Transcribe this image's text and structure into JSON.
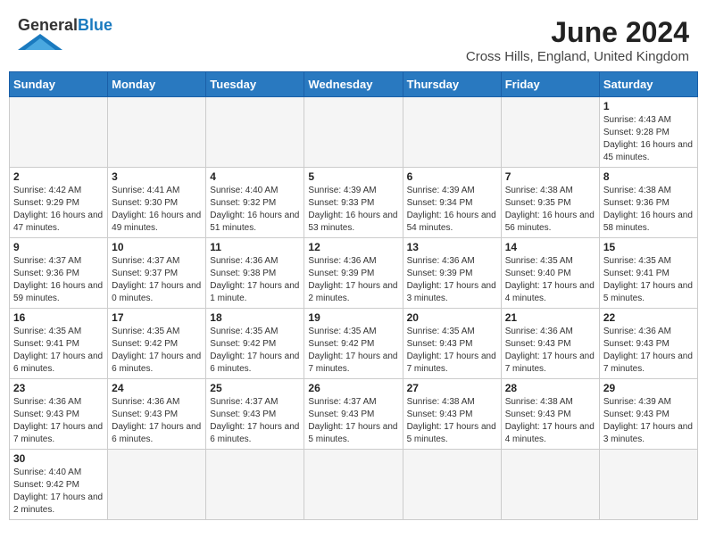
{
  "header": {
    "logo_general": "General",
    "logo_blue": "Blue",
    "month_year": "June 2024",
    "location": "Cross Hills, England, United Kingdom"
  },
  "days_of_week": [
    "Sunday",
    "Monday",
    "Tuesday",
    "Wednesday",
    "Thursday",
    "Friday",
    "Saturday"
  ],
  "weeks": [
    [
      {
        "day": "",
        "empty": true
      },
      {
        "day": "",
        "empty": true
      },
      {
        "day": "",
        "empty": true
      },
      {
        "day": "",
        "empty": true
      },
      {
        "day": "",
        "empty": true
      },
      {
        "day": "",
        "empty": true
      },
      {
        "day": "1",
        "sunrise": "4:43 AM",
        "sunset": "9:28 PM",
        "daylight": "16 hours and 45 minutes."
      }
    ],
    [
      {
        "day": "2",
        "sunrise": "4:42 AM",
        "sunset": "9:29 PM",
        "daylight": "16 hours and 47 minutes."
      },
      {
        "day": "3",
        "sunrise": "4:41 AM",
        "sunset": "9:30 PM",
        "daylight": "16 hours and 49 minutes."
      },
      {
        "day": "4",
        "sunrise": "4:40 AM",
        "sunset": "9:32 PM",
        "daylight": "16 hours and 51 minutes."
      },
      {
        "day": "5",
        "sunrise": "4:39 AM",
        "sunset": "9:33 PM",
        "daylight": "16 hours and 53 minutes."
      },
      {
        "day": "6",
        "sunrise": "4:39 AM",
        "sunset": "9:34 PM",
        "daylight": "16 hours and 54 minutes."
      },
      {
        "day": "7",
        "sunrise": "4:38 AM",
        "sunset": "9:35 PM",
        "daylight": "16 hours and 56 minutes."
      },
      {
        "day": "8",
        "sunrise": "4:38 AM",
        "sunset": "9:36 PM",
        "daylight": "16 hours and 58 minutes."
      }
    ],
    [
      {
        "day": "9",
        "sunrise": "4:37 AM",
        "sunset": "9:36 PM",
        "daylight": "16 hours and 59 minutes."
      },
      {
        "day": "10",
        "sunrise": "4:37 AM",
        "sunset": "9:37 PM",
        "daylight": "17 hours and 0 minutes."
      },
      {
        "day": "11",
        "sunrise": "4:36 AM",
        "sunset": "9:38 PM",
        "daylight": "17 hours and 1 minute."
      },
      {
        "day": "12",
        "sunrise": "4:36 AM",
        "sunset": "9:39 PM",
        "daylight": "17 hours and 2 minutes."
      },
      {
        "day": "13",
        "sunrise": "4:36 AM",
        "sunset": "9:39 PM",
        "daylight": "17 hours and 3 minutes."
      },
      {
        "day": "14",
        "sunrise": "4:35 AM",
        "sunset": "9:40 PM",
        "daylight": "17 hours and 4 minutes."
      },
      {
        "day": "15",
        "sunrise": "4:35 AM",
        "sunset": "9:41 PM",
        "daylight": "17 hours and 5 minutes."
      }
    ],
    [
      {
        "day": "16",
        "sunrise": "4:35 AM",
        "sunset": "9:41 PM",
        "daylight": "17 hours and 6 minutes."
      },
      {
        "day": "17",
        "sunrise": "4:35 AM",
        "sunset": "9:42 PM",
        "daylight": "17 hours and 6 minutes."
      },
      {
        "day": "18",
        "sunrise": "4:35 AM",
        "sunset": "9:42 PM",
        "daylight": "17 hours and 6 minutes."
      },
      {
        "day": "19",
        "sunrise": "4:35 AM",
        "sunset": "9:42 PM",
        "daylight": "17 hours and 7 minutes."
      },
      {
        "day": "20",
        "sunrise": "4:35 AM",
        "sunset": "9:43 PM",
        "daylight": "17 hours and 7 minutes."
      },
      {
        "day": "21",
        "sunrise": "4:36 AM",
        "sunset": "9:43 PM",
        "daylight": "17 hours and 7 minutes."
      },
      {
        "day": "22",
        "sunrise": "4:36 AM",
        "sunset": "9:43 PM",
        "daylight": "17 hours and 7 minutes."
      }
    ],
    [
      {
        "day": "23",
        "sunrise": "4:36 AM",
        "sunset": "9:43 PM",
        "daylight": "17 hours and 7 minutes."
      },
      {
        "day": "24",
        "sunrise": "4:36 AM",
        "sunset": "9:43 PM",
        "daylight": "17 hours and 6 minutes."
      },
      {
        "day": "25",
        "sunrise": "4:37 AM",
        "sunset": "9:43 PM",
        "daylight": "17 hours and 6 minutes."
      },
      {
        "day": "26",
        "sunrise": "4:37 AM",
        "sunset": "9:43 PM",
        "daylight": "17 hours and 5 minutes."
      },
      {
        "day": "27",
        "sunrise": "4:38 AM",
        "sunset": "9:43 PM",
        "daylight": "17 hours and 5 minutes."
      },
      {
        "day": "28",
        "sunrise": "4:38 AM",
        "sunset": "9:43 PM",
        "daylight": "17 hours and 4 minutes."
      },
      {
        "day": "29",
        "sunrise": "4:39 AM",
        "sunset": "9:43 PM",
        "daylight": "17 hours and 3 minutes."
      }
    ],
    [
      {
        "day": "30",
        "sunrise": "4:40 AM",
        "sunset": "9:42 PM",
        "daylight": "17 hours and 2 minutes."
      },
      {
        "day": "",
        "empty": true
      },
      {
        "day": "",
        "empty": true
      },
      {
        "day": "",
        "empty": true
      },
      {
        "day": "",
        "empty": true
      },
      {
        "day": "",
        "empty": true
      },
      {
        "day": "",
        "empty": true
      }
    ]
  ]
}
